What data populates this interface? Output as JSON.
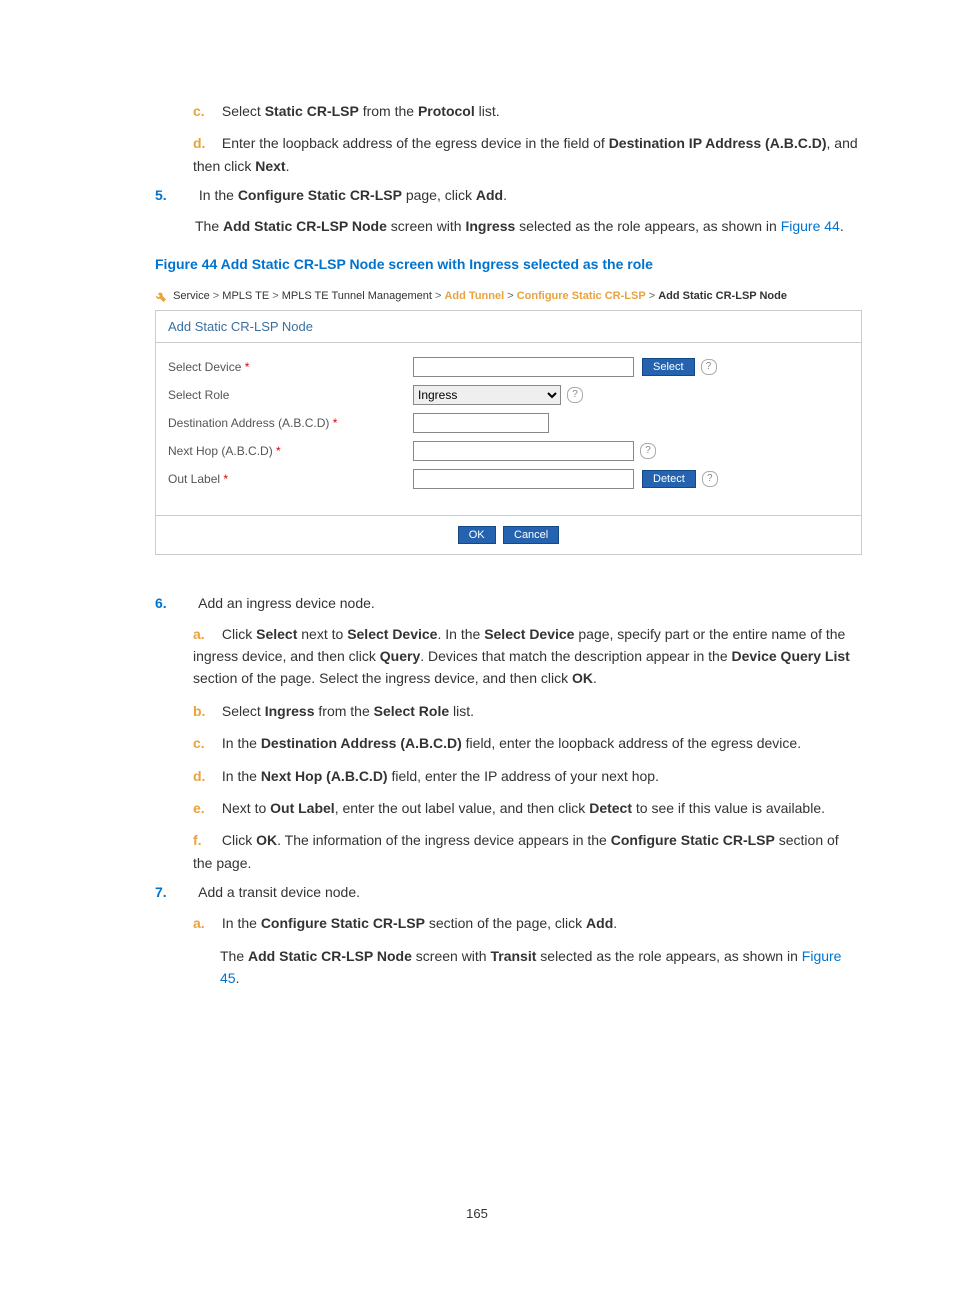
{
  "steps": {
    "c_text_pre": "Select ",
    "c_b1": "Static CR-LSP",
    "c_text_mid": " from the ",
    "c_b2": "Protocol",
    "c_text_post": " list.",
    "d_text_pre": "Enter the loopback address of the egress device in the field of ",
    "d_b1": "Destination IP Address (A.B.C.D)",
    "d_text_mid": ", and then click ",
    "d_b2": "Next",
    "d_text_post": "."
  },
  "step5": {
    "num": "5.",
    "text_pre": "In the ",
    "b1": "Configure Static CR-LSP",
    "text_mid": " page, click ",
    "b2": "Add",
    "text_post": ".",
    "line2_pre": "The ",
    "line2_b1": "Add Static CR-LSP Node",
    "line2_mid": " screen with ",
    "line2_b2": "Ingress",
    "line2_mid2": " selected as the role appears, as shown in ",
    "line2_link": "Figure 44",
    "line2_post": "."
  },
  "figcap": "Figure 44 Add Static CR-LSP Node screen with Ingress selected as the role",
  "shot": {
    "breadcrumb": {
      "a": "Service",
      "b": "MPLS TE",
      "c": "MPLS TE Tunnel Management",
      "d": "Add Tunnel",
      "e": "Configure Static CR-LSP",
      "f": "Add Static CR-LSP Node",
      "sep": " > "
    },
    "title": "Add Static CR-LSP Node",
    "labels": {
      "select_device": "Select Device",
      "select_role": "Select Role",
      "dest": "Destination Address (A.B.C.D)",
      "nexthop": "Next Hop (A.B.C.D)",
      "outlabel": "Out Label"
    },
    "role_value": "Ingress",
    "btn_select": "Select",
    "btn_detect": "Detect",
    "btn_ok": "OK",
    "btn_cancel": "Cancel"
  },
  "step6": {
    "num": "6.",
    "text": "Add an ingress device node.",
    "a_pre": "Click ",
    "a_b1": "Select",
    "a_mid1": " next to ",
    "a_b2": "Select Device",
    "a_mid2": ". In the ",
    "a_b3": "Select Device",
    "a_mid3": " page, specify part or the entire name of the ingress device, and then click ",
    "a_b4": "Query",
    "a_mid4": ". Devices that match the description appear in the ",
    "a_b5": "Device Query List",
    "a_mid5": " section of the page. Select the ingress device, and then click ",
    "a_b6": "OK",
    "a_post": ".",
    "b_pre": "Select ",
    "b_b1": "Ingress",
    "b_mid": " from the ",
    "b_b2": "Select Role",
    "b_post": " list.",
    "c_pre": "In the ",
    "c_b1": "Destination Address (A.B.C.D)",
    "c_post": " field, enter the loopback address of the egress device.",
    "d_pre": "In the ",
    "d_b1": "Next Hop (A.B.C.D)",
    "d_post": " field, enter the IP address of your next hop.",
    "e_pre": "Next to ",
    "e_b1": "Out Label",
    "e_mid": ", enter the out label value, and then click ",
    "e_b2": "Detect",
    "e_post": " to see if this value is available.",
    "f_pre": "Click ",
    "f_b1": "OK",
    "f_mid": ". The information of the ingress device appears in the ",
    "f_b2": "Configure Static CR-LSP",
    "f_post": " section of the page."
  },
  "step7": {
    "num": "7.",
    "text": "Add a transit device node.",
    "a_pre": "In the ",
    "a_b1": "Configure Static CR-LSP",
    "a_mid": " section of the page, click ",
    "a_b2": "Add",
    "a_post": ".",
    "line2_pre": "The ",
    "line2_b1": "Add Static CR-LSP Node",
    "line2_mid": " screen with ",
    "line2_b2": "Transit",
    "line2_mid2": " selected as the role appears, as shown in ",
    "line2_link": "Figure 45",
    "line2_post": "."
  },
  "letters": {
    "a": "a.",
    "b": "b.",
    "c": "c.",
    "d": "d.",
    "e": "e.",
    "f": "f."
  },
  "pagenum": "165"
}
